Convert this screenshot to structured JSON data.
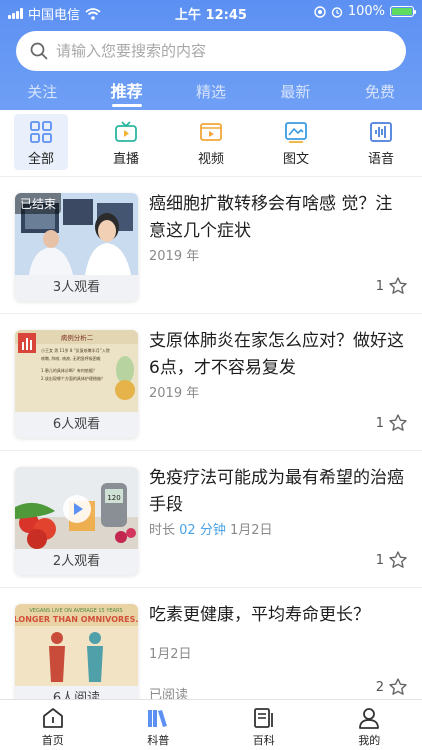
{
  "status_bar": {
    "carrier": "中国电信",
    "time": "上午 12:45",
    "battery_percent": "100%",
    "icons": [
      "signal-icon",
      "wifi-icon",
      "location-icon",
      "alarm-icon",
      "battery-icon"
    ]
  },
  "search": {
    "placeholder": "请输入您要搜索的内容",
    "value": "",
    "icon": "search-icon"
  },
  "top_tabs": [
    {
      "label": "关注",
      "active": false
    },
    {
      "label": "推荐",
      "active": true
    },
    {
      "label": "精选",
      "active": false
    },
    {
      "label": "最新",
      "active": false
    },
    {
      "label": "免费",
      "active": false
    }
  ],
  "categories": [
    {
      "label": "全部",
      "icon": "grid-icon",
      "active": true
    },
    {
      "label": "直播",
      "icon": "tv-icon",
      "active": false
    },
    {
      "label": "视频",
      "icon": "video-icon",
      "active": false
    },
    {
      "label": "图文",
      "icon": "image-text-icon",
      "active": false
    },
    {
      "label": "语音",
      "icon": "audio-icon",
      "active": false
    }
  ],
  "feed": [
    {
      "title": "癌细胞扩散转移会有啥感 觉？注意这几个症状",
      "meta": "2019 年",
      "badge": "已结束",
      "views": "3人观看",
      "likes": "1"
    },
    {
      "title": "支原体肺炎在家怎么应对？做好这6点，才不容易复发",
      "meta": "2019 年",
      "views": "6人观看",
      "likes": "1"
    },
    {
      "title": "免疫疗法可能成为最有希望的治癌手段",
      "meta_prefix": "时长",
      "meta_duration": "02 分钟",
      "meta_suffix": "1月2日",
      "views": "2人观看",
      "likes": "1"
    },
    {
      "title": "吃素更健康，平均寿命更长？",
      "meta": "1月2日",
      "views": "6人阅读",
      "extra": "已阅读",
      "likes": "2"
    }
  ],
  "thumb_text": {
    "case_title": "病例分析二",
    "case_lines": [
      "小王女 男 11岁 8 “反复咳嗽半月”入院",
      "咳嗽, 阵咳, 咳痰, 无明显呼吸困难",
      "1.患儿的具体诊断？有何依据？",
      "2.该出现哪个方面的具体护理措施？"
    ],
    "meter_value": "120",
    "veg_banner_1": "VEGANS LIVE ON AVERAGE 15 YEARS",
    "veg_banner_2": "LONGER THAN OMNIVORES."
  },
  "bottom_nav": [
    {
      "label": "首页",
      "icon": "home-icon",
      "active": false
    },
    {
      "label": "科普",
      "icon": "book-icon",
      "active": true
    },
    {
      "label": "百科",
      "icon": "encyclopedia-icon",
      "active": false
    },
    {
      "label": "我的",
      "icon": "user-icon",
      "active": false
    }
  ],
  "colors": {
    "brand_blue": "#5c90f2",
    "accent_cyan": "#4aa3e8",
    "tab_active_bg": "#eaf0fb"
  }
}
